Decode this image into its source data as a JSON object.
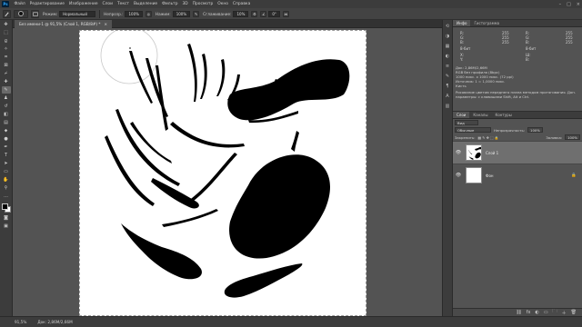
{
  "menubar": {
    "logo": "Ps",
    "items": [
      "Файл",
      "Редактирование",
      "Изображение",
      "Слои",
      "Текст",
      "Выделение",
      "Фильтр",
      "3D",
      "Просмотр",
      "Окно",
      "Справка"
    ],
    "controls": [
      "–",
      "□",
      "×"
    ]
  },
  "options": {
    "mode_label": "Режим:",
    "mode_value": "Нормальный",
    "opacity_label": "Непрозр.:",
    "opacity_value": "100%",
    "flow_label": "Нажим:",
    "flow_value": "100%",
    "smoothing_label": "Сглаживание:",
    "smoothing_value": "10%",
    "angle_value": "0°"
  },
  "document": {
    "tab_title": "Без имени-1 @ 91,5% (Слой 1, RGB/8#) *",
    "tab_close": "×"
  },
  "status": {
    "zoom": "91,5%",
    "doc_info": "Док: 2,86М/2,66М"
  },
  "info_panel": {
    "tabs": [
      "Инфо",
      "Гистограмма"
    ],
    "r_label": "R:",
    "g_label": "G:",
    "b_label": "B:",
    "r1": "255",
    "g1": "255",
    "b1": "255",
    "r2": "255",
    "g2": "255",
    "b2": "255",
    "bit1": "8-бит",
    "bit2": "8-бит",
    "x_label": "X:",
    "y_label": "Y:",
    "w_label": "Ш:",
    "h_label": "В:",
    "doc_line1": "Док: 2,86М/2,66М",
    "doc_line2": "RGB без профиля (8bpc)",
    "doc_line3": "1000 пикс. x 1000 пикс. (72 ppi)",
    "doc_line4": "Источник: 1 = 1,0000 пикс.",
    "doc_line5": "Кисть",
    "hint": "Рисование цветом переднего плана методом протягивания. Доп. параметры: с клавишами Shift, Alt и Ctrl."
  },
  "layers_panel": {
    "tabs": [
      "Слои",
      "Каналы",
      "Контуры"
    ],
    "kind_value": "Вид",
    "blend_value": "Обычные",
    "opacity_label": "Непрозрачность:",
    "opacity_value": "100%",
    "lock_label": "Закрепить:",
    "fill_label": "Заливка:",
    "fill_value": "100%",
    "layers": [
      {
        "name": "Слой 1",
        "selected": true
      },
      {
        "name": "Фон",
        "selected": false
      }
    ],
    "footer_icons": [
      "fx",
      "◐",
      "▭",
      "🗀",
      "＋",
      "🗑"
    ]
  },
  "colors": {
    "foreground": "#000000",
    "background": "#ffffff"
  }
}
